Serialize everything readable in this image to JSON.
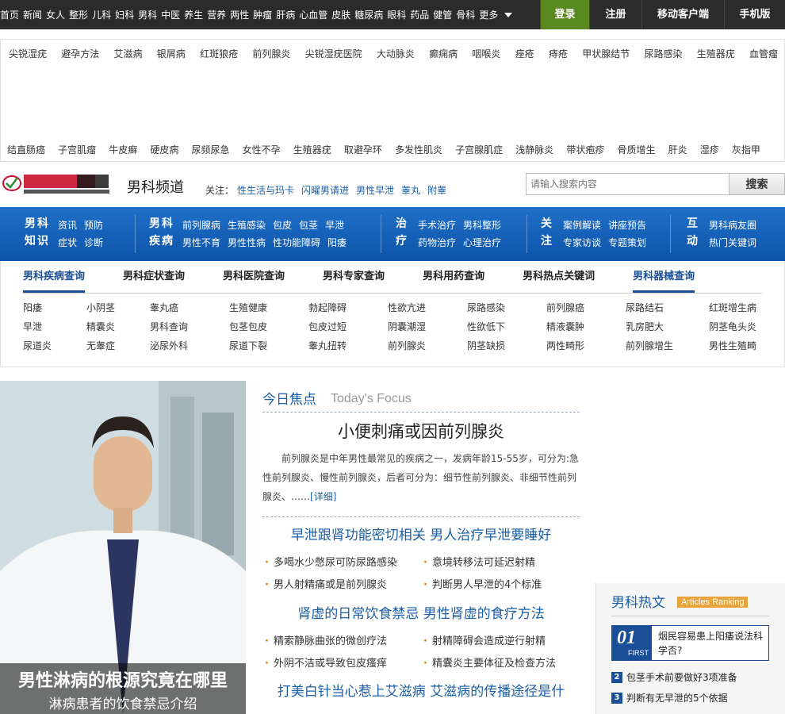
{
  "topnav": {
    "items": [
      "首页",
      "新闻",
      "女人",
      "整形",
      "儿科",
      "妇科",
      "男科",
      "中医",
      "养生",
      "营养",
      "两性",
      "肿瘤",
      "肝病",
      "心血管",
      "皮肤",
      "糖尿病",
      "眼科",
      "药品",
      "健管",
      "骨科"
    ],
    "more": "更多"
  },
  "topbuttons": {
    "login": "登录",
    "register": "注册",
    "mobile": "移动客户端",
    "phone": "手机版"
  },
  "keywords": {
    "row1": [
      "尖锐湿疣",
      "避孕方法",
      "艾滋病",
      "银屑病",
      "红斑狼疮",
      "前列腺炎",
      "尖锐湿疣医院",
      "大动脉炎",
      "癫痫病",
      "咽喉炎",
      "痤疮",
      "痔疮",
      "甲状腺结节",
      "尿路感染",
      "生殖器疣",
      "血管瘤"
    ],
    "row2": [
      "结直肠癌",
      "子宫肌瘤",
      "牛皮癣",
      "硬皮病",
      "尿频尿急",
      "女性不孕",
      "生殖器疣",
      "取避孕环",
      "多发性肌炎",
      "子宫腺肌症",
      "浅静脉炎",
      "带状疱疹",
      "骨质增生",
      "肝炎",
      "湿疹",
      "灰指甲"
    ]
  },
  "header": {
    "channel": "男科频道",
    "focus_label": "关注：",
    "focus_links": [
      "性生活与玛卡",
      "闪曜男请进",
      "男性早泄",
      "睾丸",
      "附睾"
    ],
    "search_placeholder": "请输入搜索内容",
    "search_button": "搜索"
  },
  "bluenav": [
    {
      "title": "男科知识",
      "rows": [
        [
          "资讯",
          "预防"
        ],
        [
          "症状",
          "诊断"
        ]
      ]
    },
    {
      "title": "男科疾病",
      "rows": [
        [
          "前列腺病",
          "生殖感染",
          "包皮",
          "包茎",
          "早泄"
        ],
        [
          "男性不育",
          "男性性病",
          "性功能障碍",
          "阳痿"
        ]
      ]
    },
    {
      "title": "治疗",
      "rows": [
        [
          "手术治疗",
          "男科整形"
        ],
        [
          "药物治疗",
          "心理治疗"
        ]
      ]
    },
    {
      "title": "关注",
      "rows": [
        [
          "案例解读",
          "讲座预告"
        ],
        [
          "专家访谈",
          "专题策划"
        ]
      ]
    },
    {
      "title": "互动",
      "rows": [
        [
          "男科病友圈"
        ],
        [
          "热门关键词"
        ]
      ]
    }
  ],
  "query": {
    "tabs": [
      "男科疾病查询",
      "男科症状查询",
      "男科医院查询",
      "男科专家查询",
      "男科用药查询",
      "男科热点关键词",
      "男科器械查询"
    ],
    "active_tab": 0,
    "grid": [
      "阳痿",
      "小阴茎",
      "睾丸癌",
      "生殖健康",
      "勃起障碍",
      "性欲亢进",
      "尿路感染",
      "前列腺癌",
      "尿路结石",
      "红斑增生病",
      "早泄",
      "精囊炎",
      "男科查询",
      "包茎包皮",
      "包皮过短",
      "阴囊潮湿",
      "性欲低下",
      "精液囊肿",
      "乳房肥大",
      "阴茎龟头炎",
      "尿道炎",
      "无睾症",
      "泌尿外科",
      "尿道下裂",
      "睾丸扭转",
      "前列腺炎",
      "阴茎缺损",
      "两性畸形",
      "前列腺增生",
      "男性生殖畸"
    ]
  },
  "hero": {
    "caption1": "男性淋病的根源究竟在哪里",
    "caption2": "淋病患者的饮食禁忌介绍"
  },
  "focus": {
    "title": "今日焦点",
    "subtitle": "Today's Focus",
    "headline": "小便刺痛或因前列腺炎",
    "summary": "前列腺炎是中年男性最常见的疾病之一，发病年龄15-55岁，可分为:急性前列腺炎、慢性前列腺炎，后者可分为：细节性前列腺炎、非细节性前列腺炎、……",
    "detail": "[详细]"
  },
  "sections": [
    {
      "head": "早泄跟肾功能密切相关 男人治疗早泄要睡好",
      "rows": [
        [
          "多喝水少憋尿可防尿路感染",
          "意境转移法可延迟射精"
        ],
        [
          "男人射精痛或是前列腺炎",
          "判断男人早泄的4个标准"
        ]
      ]
    },
    {
      "head": "肾虚的日常饮食禁忌 男性肾虚的食疗方法",
      "rows": [
        [
          "精索静脉曲张的微创疗法",
          "射精障碍会造成逆行射精"
        ],
        [
          "外阴不洁或导致包皮瘙痒",
          "精囊炎主要体征及检查方法"
        ]
      ]
    },
    {
      "head": "打美白针当心惹上艾滋病 艾滋病的传播途径是什",
      "rows": []
    }
  ],
  "ranking": {
    "title": "男科热文",
    "badge": "Articles Ranking",
    "first_num": "01",
    "first_label": "FIRST",
    "first_text": "烟民容易患上阳痿说法科学否?",
    "items": [
      {
        "n": "2",
        "t": "包茎手术前要做好3项准备"
      },
      {
        "n": "3",
        "t": "判断有无早泄的5个依据"
      }
    ]
  }
}
